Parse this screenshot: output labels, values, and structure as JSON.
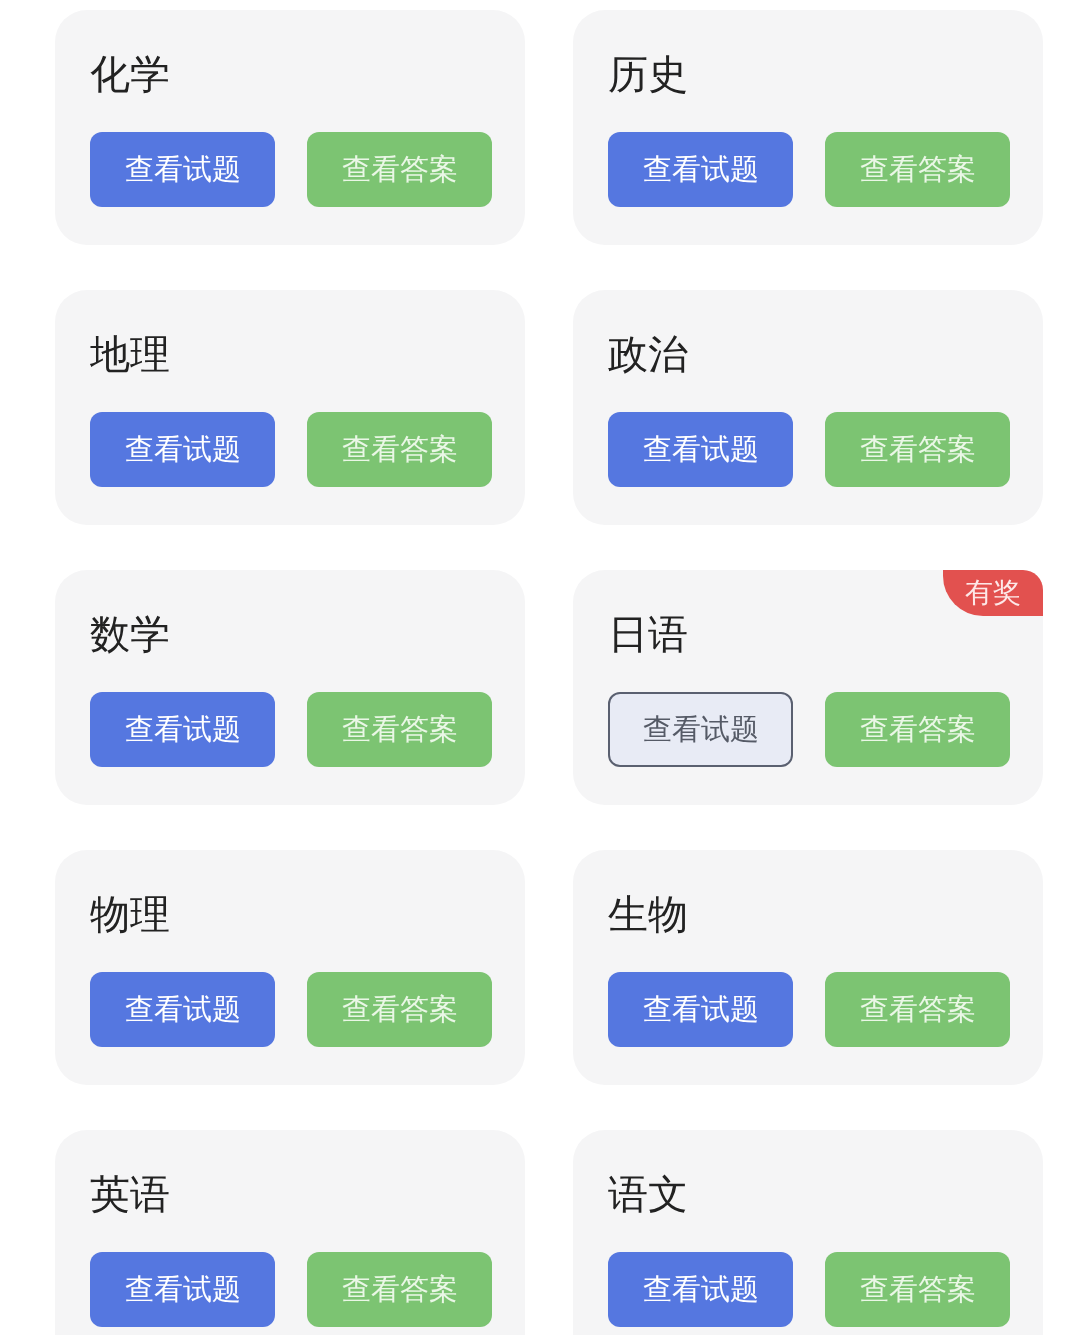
{
  "rows": [
    {
      "cards": [
        {
          "name": "化学",
          "question_button": "查看试题",
          "answer_button": "查看答案",
          "outlined": false
        },
        {
          "name": "历史",
          "question_button": "查看试题",
          "answer_button": "查看答案",
          "outlined": false
        }
      ]
    },
    {
      "cards": [
        {
          "name": "地理",
          "question_button": "查看试题",
          "answer_button": "查看答案",
          "outlined": false
        },
        {
          "name": "政治",
          "question_button": "查看试题",
          "answer_button": "查看答案",
          "outlined": false
        }
      ]
    },
    {
      "cards": [
        {
          "name": "数学",
          "question_button": "查看试题",
          "answer_button": "查看答案",
          "outlined": false
        },
        {
          "name": "日语",
          "question_button": "查看试题",
          "answer_button": "查看答案",
          "outlined": true,
          "badge": "有奖"
        }
      ]
    },
    {
      "cards": [
        {
          "name": "物理",
          "question_button": "查看试题",
          "answer_button": "查看答案",
          "outlined": false
        },
        {
          "name": "生物",
          "question_button": "查看试题",
          "answer_button": "查看答案",
          "outlined": false
        }
      ]
    },
    {
      "cards": [
        {
          "name": "英语",
          "question_button": "查看试题",
          "answer_button": "查看答案",
          "outlined": false
        },
        {
          "name": "语文",
          "question_button": "查看试题",
          "answer_button": "查看答案",
          "outlined": false
        }
      ]
    }
  ]
}
